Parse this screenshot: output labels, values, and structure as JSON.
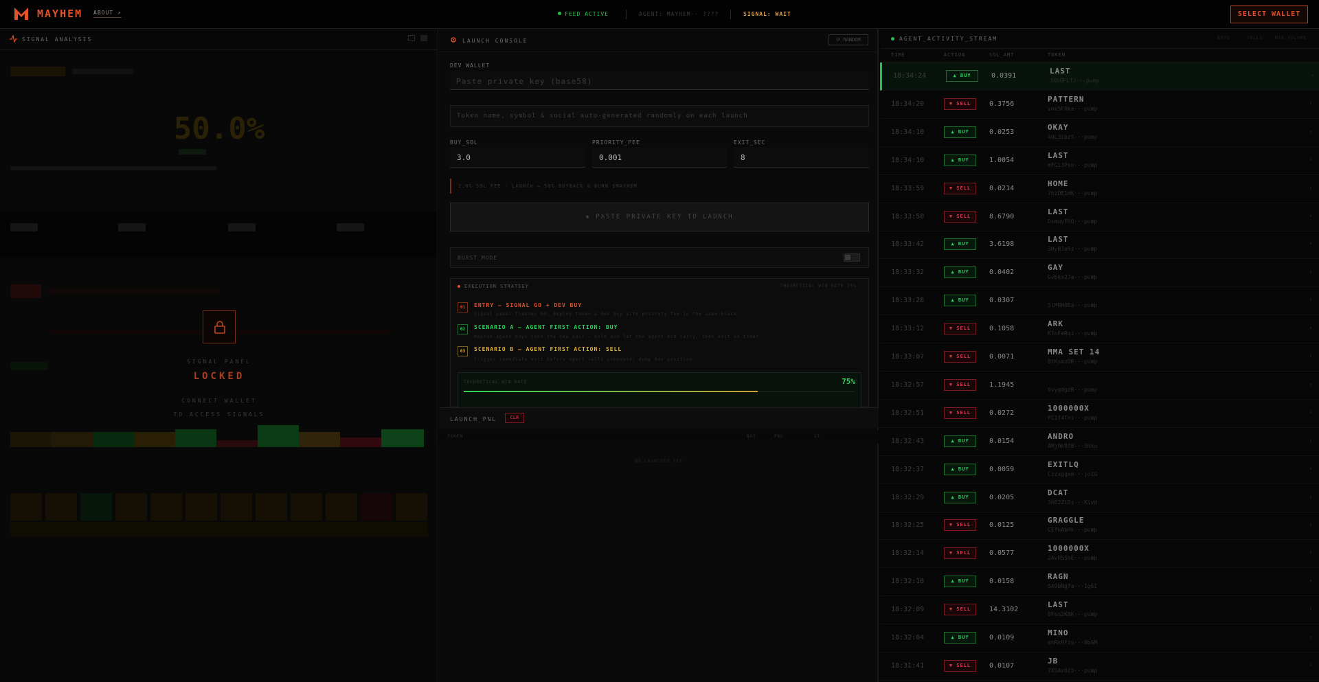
{
  "header": {
    "brand": "MAYHEM",
    "about": "ABOUT ↗",
    "feed_status": "FEED ACTIVE",
    "agent_label": "AGENT: MAYHEM·· ????",
    "signal_status": "SIGNAL: WAIT",
    "select_wallet": "SELECT WALLET"
  },
  "signal_panel": {
    "title": "SIGNAL ANALYSIS",
    "big_value": "50.0%",
    "state_label": "SIGNAL PANEL",
    "locked": "LOCKED",
    "connect_line1": "CONNECT WALLET",
    "connect_line2": "TO ACCESS SIGNALS"
  },
  "launch_console": {
    "title": "LAUNCH CONSOLE",
    "random_btn": "⟳ RANDOM",
    "dev_wallet_label": "DEV WALLET",
    "private_key_placeholder": "Paste private key (base58)",
    "token_info_placeholder": "Token name, symbol & social auto-generated randomly on each launch",
    "buy_sol_label": "BUY_SOL",
    "buy_sol_value": "3.0",
    "priority_fee_label": "PRIORITY_FEE",
    "priority_fee_value": "0.001",
    "exit_sec_label": "EXIT_SEC",
    "exit_sec_value": "8",
    "fee_note": "2.0% SOL FEE · LAUNCH → 50% BUYBACK & BURN $MAYHEM",
    "launch_button": "◈ PASTE PRIVATE KEY TO LAUNCH",
    "burst_mode": "BURST_MODE",
    "strategy_title": "EXECUTION STRATEGY",
    "strategy_note": "THEORETICAL WIN RATE 75%",
    "steps": [
      {
        "num": "01",
        "title": "ENTRY — SIGNAL GO + DEV BUY",
        "desc": "Signal panel flashes GO; deploy token & dev buy with priority fee in the same block.",
        "color": "#e2512a"
      },
      {
        "num": "02",
        "title": "SCENARIO A — AGENT FIRST ACTION: BUY",
        "desc": "Mayhem agent buys into the new pair — hold and let the agent bid carry, then exit on timer.",
        "color": "#2bd45a"
      },
      {
        "num": "03",
        "title": "SCENARIO B — AGENT FIRST ACTION: SELL",
        "desc": "Trigger immediate exit before agent sells compound; dump dev position.",
        "color": "#e0b040"
      }
    ],
    "win_rate_label": "THEORETICAL WIN RATE",
    "win_rate_value": "75%",
    "win_rate_fraction": 0.75
  },
  "launch_pnl": {
    "title": "LAUNCH_PNL",
    "clear_btn": "CLR",
    "columns": [
      "TOKEN",
      "BUY",
      "PNL",
      "ST"
    ],
    "empty_text": "NO LAUNCHES YET"
  },
  "activity": {
    "title": "AGENT_ACTIVITY_STREAM",
    "filters": [
      "BUYS",
      "SELLS",
      "MIN VOLUME"
    ],
    "columns": [
      "TIME",
      "ACTION",
      "SOL_AMT",
      "TOKEN"
    ],
    "rows": [
      {
        "time": "18:34:24",
        "action": "BUY",
        "amt": "0.0391",
        "name": "LAST",
        "ca": "3XbGFLTJ···pump"
      },
      {
        "time": "18:34:20",
        "action": "SELL",
        "amt": "0.3756",
        "name": "PATTERN",
        "ca": "vnk5FRka···pump"
      },
      {
        "time": "18:34:10",
        "action": "BUY",
        "amt": "0.0253",
        "name": "OKAY",
        "ca": "4dL3ibzS···pump"
      },
      {
        "time": "18:34:10",
        "action": "BUY",
        "amt": "1.0054",
        "name": "LAST",
        "ca": "mFGi3Psn···pump"
      },
      {
        "time": "18:33:59",
        "action": "SELL",
        "amt": "0.0214",
        "name": "HOME",
        "ca": "7hzDE1mK···pump"
      },
      {
        "time": "18:33:50",
        "action": "SELL",
        "amt": "8.6790",
        "name": "LAST",
        "ca": "DsmuyFHQ···pump"
      },
      {
        "time": "18:33:42",
        "action": "BUY",
        "amt": "3.6198",
        "name": "LAST",
        "ca": "3HyBJe9z···pump"
      },
      {
        "time": "18:33:32",
        "action": "BUY",
        "amt": "0.0402",
        "name": "GAY",
        "ca": "Gvbkx2Ja···pump"
      },
      {
        "time": "18:33:28",
        "action": "BUY",
        "amt": "0.0307",
        "name": "",
        "ca": "5iMRW8Ea···pump"
      },
      {
        "time": "18:33:12",
        "action": "SELL",
        "amt": "0.1058",
        "name": "ARK",
        "ca": "KTnFeRqi···pump"
      },
      {
        "time": "18:33:07",
        "action": "SELL",
        "amt": "0.0071",
        "name": "MMA SET 14",
        "ca": "8tKsmzDR···pump"
      },
      {
        "time": "18:32:57",
        "action": "SELL",
        "amt": "1.1945",
        "name": "",
        "ca": "6vygdgzR···pump"
      },
      {
        "time": "18:32:51",
        "action": "SELL",
        "amt": "0.0272",
        "name": "1000000X",
        "ca": "FC1f4Tni···pump"
      },
      {
        "time": "18:32:43",
        "action": "BUY",
        "amt": "0.0154",
        "name": "ANDRO",
        "ca": "AMj9kRfB···3hku"
      },
      {
        "time": "18:32:37",
        "action": "BUY",
        "amt": "0.0059",
        "name": "EXITLQ",
        "ca": "Czzxggxm···joIG"
      },
      {
        "time": "18:32:29",
        "action": "BUY",
        "amt": "0.0205",
        "name": "DCAT",
        "ca": "3hE2ZiDs···Kivd"
      },
      {
        "time": "18:32:25",
        "action": "SELL",
        "amt": "0.0125",
        "name": "GRAGGLE",
        "ca": "CEfkAbHk···pump"
      },
      {
        "time": "18:32:14",
        "action": "SELL",
        "amt": "0.0577",
        "name": "1000000X",
        "ca": "2AvR5SbE···pump"
      },
      {
        "time": "18:32:10",
        "action": "BUY",
        "amt": "0.0158",
        "name": "RAGN",
        "ca": "5A9bNgfa···1g6I"
      },
      {
        "time": "18:32:09",
        "action": "SELL",
        "amt": "14.3102",
        "name": "LAST",
        "ca": "8Fsn2KBK···pump"
      },
      {
        "time": "18:32:04",
        "action": "BUY",
        "amt": "0.0109",
        "name": "MINO",
        "ca": "mhRk9Fzu···BbGM"
      },
      {
        "time": "18:31:41",
        "action": "SELL",
        "amt": "0.0107",
        "name": "JB",
        "ca": "7XSAx6z5···pump"
      }
    ]
  },
  "colors": {
    "accent": "#e2512a",
    "buy": "#2bd45a",
    "sell": "#e2374a",
    "warn": "#e0a24a"
  }
}
